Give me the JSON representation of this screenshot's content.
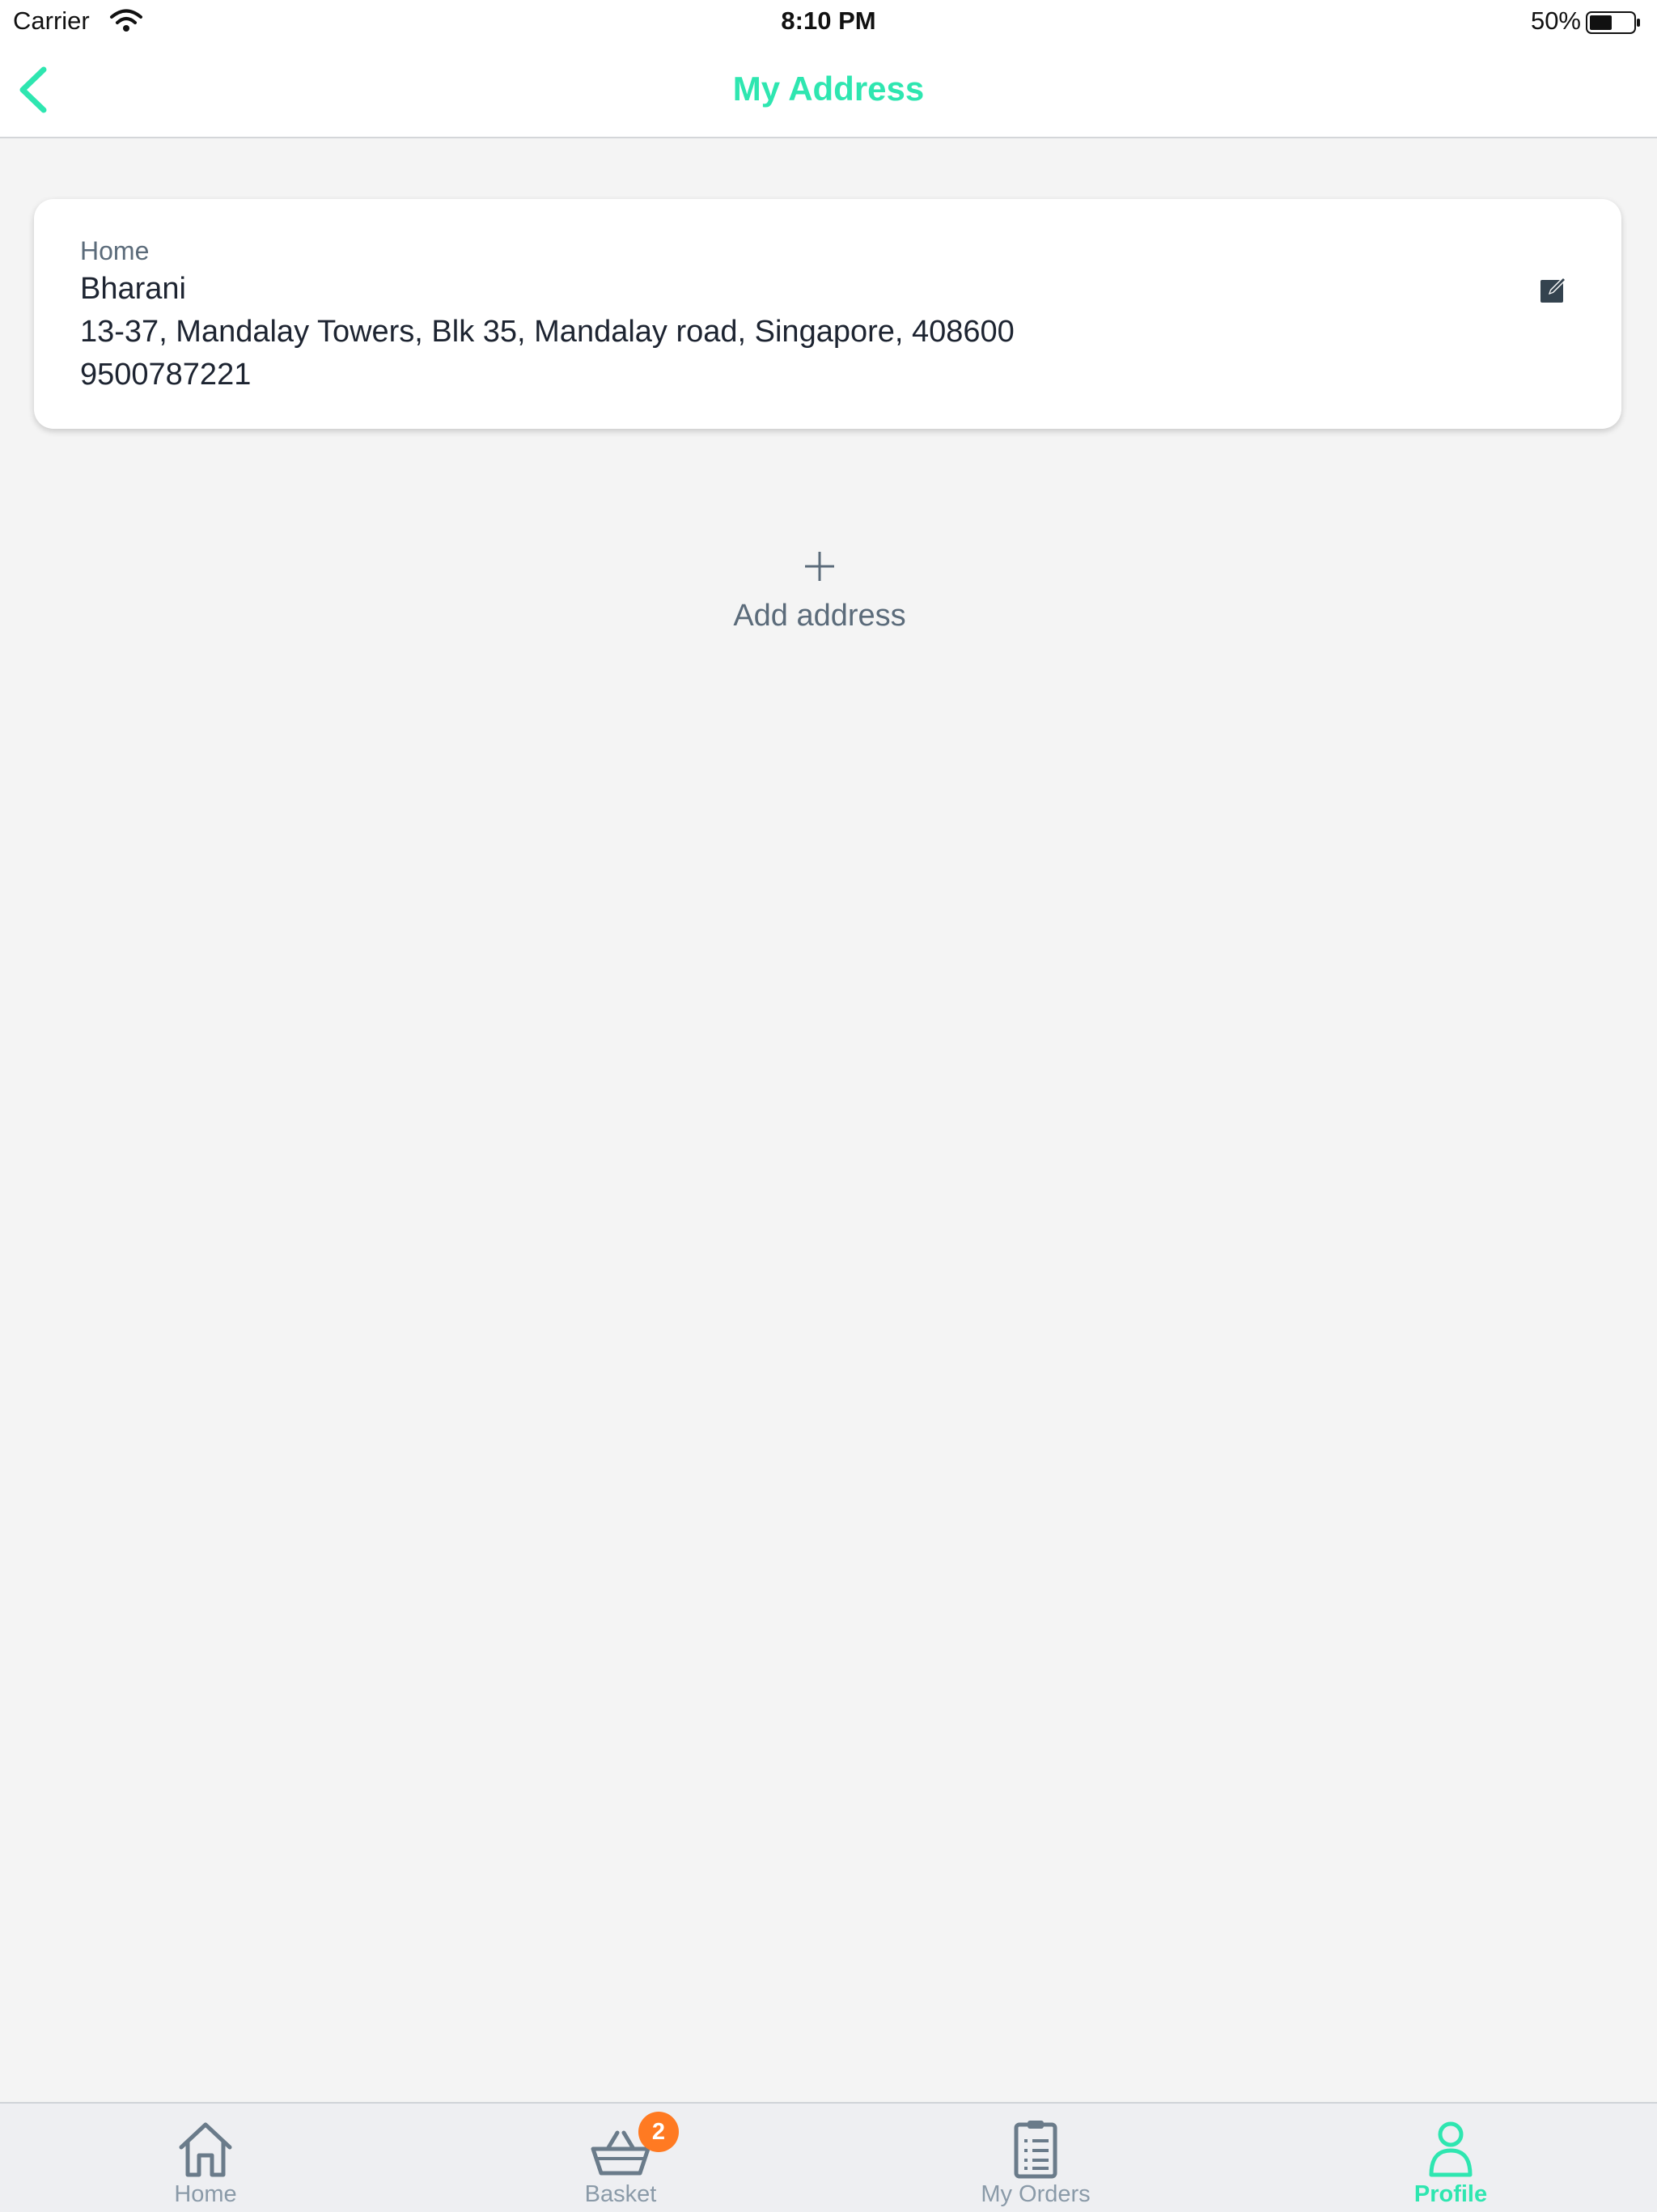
{
  "status_bar": {
    "carrier": "Carrier",
    "time": "8:10 PM",
    "battery": "50%"
  },
  "nav": {
    "title": "My Address"
  },
  "address": {
    "label": "Home",
    "name": "Bharani",
    "line": "13-37, Mandalay Towers, Blk 35, Mandalay road, Singapore, 408600",
    "phone": "9500787221"
  },
  "add_address": {
    "label": "Add address"
  },
  "tabs": [
    {
      "label": "Home",
      "icon": "home-icon"
    },
    {
      "label": "Basket",
      "icon": "basket-icon",
      "badge": "2"
    },
    {
      "label": "My Orders",
      "icon": "clipboard-icon"
    },
    {
      "label": "Profile",
      "icon": "person-icon",
      "active": true
    }
  ],
  "colors": {
    "accent": "#2ee6b0",
    "badge": "#ff7a22",
    "muted": "#8a9aa8"
  }
}
